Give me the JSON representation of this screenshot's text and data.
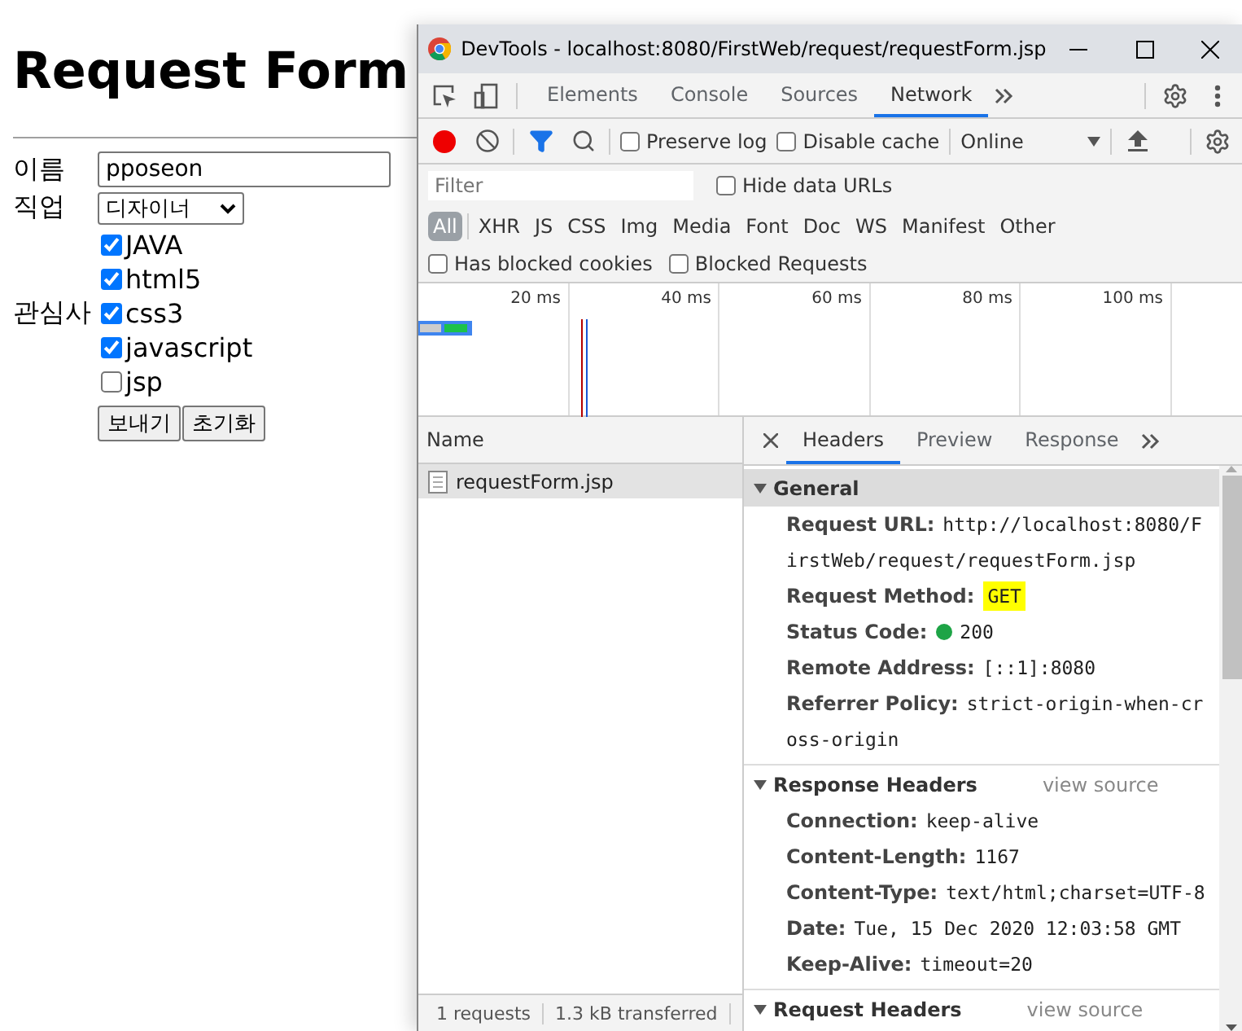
{
  "page": {
    "heading": "Request Form",
    "fields": [
      {
        "kind": "text",
        "label": "이름",
        "value": "pposeon"
      },
      {
        "kind": "select",
        "label": "직업",
        "value": "디자이너"
      },
      {
        "kind": "checkboxes",
        "label": "관심사",
        "options": [
          {
            "label": "JAVA",
            "checked": true
          },
          {
            "label": "html5",
            "checked": true
          },
          {
            "label": "css3",
            "checked": true
          },
          {
            "label": "javascript",
            "checked": true
          },
          {
            "label": "jsp",
            "checked": false
          }
        ]
      }
    ],
    "buttons": [
      "보내기",
      "초기화"
    ]
  },
  "devtools": {
    "title": "DevTools - localhost:8080/FirstWeb/request/requestForm.jsp",
    "tabs": [
      {
        "label": "Elements",
        "selected": false
      },
      {
        "label": "Console",
        "selected": false
      },
      {
        "label": "Sources",
        "selected": false
      },
      {
        "label": "Network",
        "selected": true
      }
    ],
    "toolbar": {
      "options": [
        {
          "label": "Preserve log",
          "checked": false
        },
        {
          "label": "Disable cache",
          "checked": false
        }
      ],
      "throttle": "Online"
    },
    "filter": {
      "placeholder": "Filter"
    },
    "hide_data_urls": {
      "label": "Hide data URLs",
      "checked": false
    },
    "type_filters": [
      {
        "label": "All",
        "selected": true
      },
      {
        "label": "XHR",
        "selected": false
      },
      {
        "label": "JS",
        "selected": false
      },
      {
        "label": "CSS",
        "selected": false
      },
      {
        "label": "Img",
        "selected": false
      },
      {
        "label": "Media",
        "selected": false
      },
      {
        "label": "Font",
        "selected": false
      },
      {
        "label": "Doc",
        "selected": false
      },
      {
        "label": "WS",
        "selected": false
      },
      {
        "label": "Manifest",
        "selected": false
      },
      {
        "label": "Other",
        "selected": false
      }
    ],
    "blocked_filters": [
      {
        "label": "Has blocked cookies",
        "checked": false
      },
      {
        "label": "Blocked Requests",
        "checked": false
      }
    ],
    "timeline": {
      "ticks": [
        "20 ms",
        "40 ms",
        "60 ms",
        "80 ms",
        "100 ms"
      ]
    },
    "requests": {
      "column": "Name",
      "rows": [
        {
          "name": "requestForm.jsp",
          "selected": true
        }
      ]
    },
    "detail_tabs": [
      {
        "label": "Headers",
        "selected": true
      },
      {
        "label": "Preview",
        "selected": false
      },
      {
        "label": "Response",
        "selected": false
      }
    ],
    "sections": [
      {
        "title": "General",
        "expanded": true,
        "entries": [
          {
            "kind": "plain",
            "key": "Request URL:",
            "value": "http://localhost:8080/FirstWeb/request/requestForm.jsp"
          },
          {
            "kind": "highlight",
            "key": "Request Method:",
            "value": "GET"
          },
          {
            "kind": "status",
            "key": "Status Code:",
            "value": "200",
            "color": "#1ea446"
          },
          {
            "kind": "plain",
            "key": "Remote Address:",
            "value": "[::1]:8080"
          },
          {
            "kind": "plain",
            "key": "Referrer Policy:",
            "value": "strict-origin-when-cross-origin"
          }
        ]
      },
      {
        "title": "Response Headers",
        "expanded": true,
        "link": "view source",
        "entries": [
          {
            "kind": "plain",
            "key": "Connection:",
            "value": "keep-alive"
          },
          {
            "kind": "plain",
            "key": "Content-Length:",
            "value": "1167"
          },
          {
            "kind": "plain",
            "key": "Content-Type:",
            "value": "text/html;charset=UTF-8"
          },
          {
            "kind": "plain",
            "key": "Date:",
            "value": "Tue, 15 Dec 2020 12:03:58 GMT"
          },
          {
            "kind": "plain",
            "key": "Keep-Alive:",
            "value": "timeout=20"
          }
        ]
      },
      {
        "title": "Request Headers",
        "expanded": true,
        "link": "view source"
      }
    ],
    "status_bar": [
      "1 requests",
      "1.3 kB transferred"
    ]
  }
}
